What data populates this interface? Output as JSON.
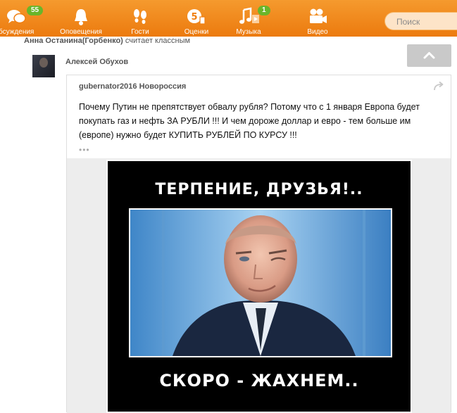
{
  "nav": {
    "items": [
      {
        "label": "бсуждения",
        "badge": "55"
      },
      {
        "label": "Оповещения"
      },
      {
        "label": "Гости"
      },
      {
        "label": "Оценки"
      },
      {
        "label": "Музыка",
        "badge": "1"
      },
      {
        "label": "Видео"
      }
    ],
    "search_placeholder": "Поиск"
  },
  "feed": {
    "activity_user": "Анна Останина(Горбенко)",
    "activity_action": "считает классным",
    "author": "Алексей Обухов",
    "group": "gubernator2016 Новороссия",
    "post_text": "Почему Путин не препятствует обвалу рубля? Потому что с 1 января Европа будет покупать газ и нефть ЗА РУБЛИ !!! И чем дороже доллар и евро - тем больше им (европе) нужно будет КУПИТЬ РУБЛЕЙ ПО КУРСУ !!!",
    "more": "•••"
  },
  "poster": {
    "top_text": "ТЕРПЕНИЕ, ДРУЗЬЯ!..",
    "bottom_text": "СКОРО - ЖАХНЕМ.."
  },
  "colors": {
    "brand": "#f07f12",
    "badge": "#6ab52a"
  },
  "icons": [
    "discussions-icon",
    "bell-icon",
    "footprints-icon",
    "ratings-icon",
    "music-icon",
    "video-camera-icon",
    "reshare-icon",
    "chevron-up-icon"
  ]
}
